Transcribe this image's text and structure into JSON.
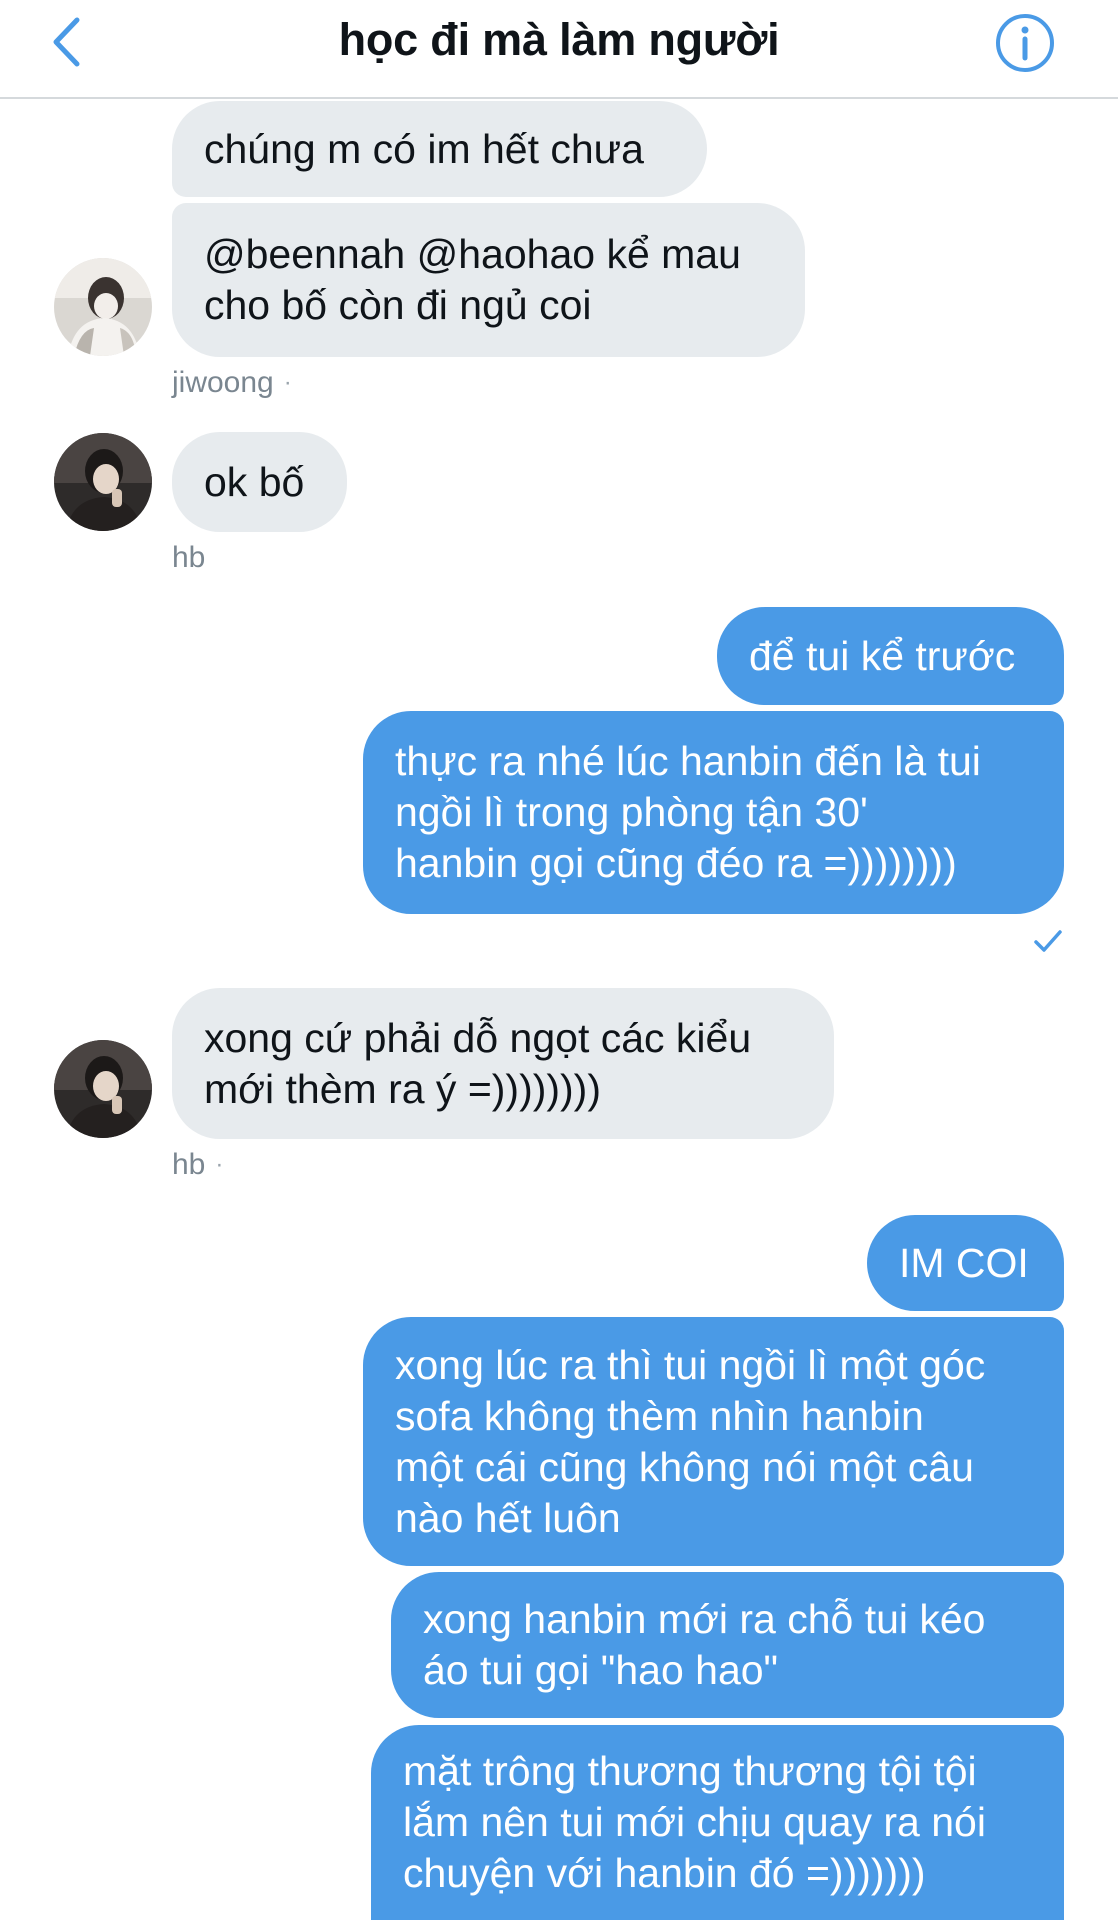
{
  "header": {
    "title": "học đi mà làm người",
    "back_icon": "chevron-left-icon",
    "info_icon": "info-icon",
    "accent": "#4a9ae6"
  },
  "messages": [
    {
      "sender": "other",
      "text": "chúng m có im hết chưa"
    },
    {
      "sender": "other",
      "text": "@beennah @haohao kể mau\ncho bố còn đi ngủ coi"
    },
    {
      "sender": "other",
      "text": "ok bố"
    },
    {
      "sender": "me",
      "text": "để tui kể trước"
    },
    {
      "sender": "me",
      "text": "thực ra nhé lúc hanbin đến là tui\nngồi lì trong phòng tận 30'\nhanbin gọi cũng đéo ra =))))))))"
    },
    {
      "sender": "other",
      "text": "xong cứ phải dỗ ngọt các kiểu\nmới thèm ra ý =))))))))"
    },
    {
      "sender": "me",
      "text": "IM COI"
    },
    {
      "sender": "me",
      "text": "xong lúc ra thì tui ngồi lì một góc\nsofa không thèm nhìn hanbin\nmột cái cũng không nói một câu\nnào hết luôn"
    },
    {
      "sender": "me",
      "text": "xong hanbin mới ra chỗ tui kéo\náo tui gọi \"hao hao\""
    },
    {
      "sender": "me",
      "text": "mặt trông thương thương tội tội\nlắm nên tui mới chịu quay ra nói\nchuyện với hanbin đó =)))))))"
    }
  ],
  "senders": {
    "jiwoong": "jiwoong",
    "hb": "hb"
  },
  "separator": "·",
  "colors": {
    "incoming_bubble": "#e7ebee",
    "outgoing_bubble": "#4a9ae6",
    "meta_text": "#7a8690"
  }
}
